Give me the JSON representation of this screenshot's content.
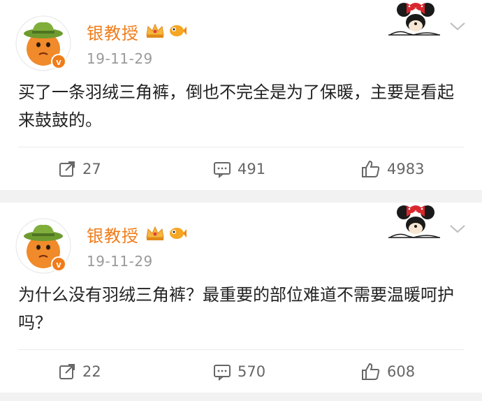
{
  "posts": [
    {
      "username": "银教授",
      "timestamp": "19-11-29",
      "content": "买了一条羽绒三角裤，倒也不完全是为了保暖，主要是看起来鼓鼓的。",
      "reposts": "27",
      "comments": "491",
      "likes": "4983"
    },
    {
      "username": "银教授",
      "timestamp": "19-11-29",
      "content": "为什么没有羽绒三角裤？最重要的部位难道不需要温暖呵护吗？",
      "reposts": "22",
      "comments": "570",
      "likes": "608"
    }
  ],
  "colors": {
    "username": "#f07c1a",
    "verified": "#f07c1a",
    "text": "#222222",
    "muted": "#9a9a9a",
    "background": "#f2f2f2"
  },
  "icons": {
    "avatar": "cartoon-cowboy-avatar",
    "verified": "verified-v-badge",
    "crown": "crown-badge",
    "fish": "fish-badge",
    "decor": "minnie-mouse-decoration",
    "chevron": "chevron-down-icon",
    "repost": "repost-icon",
    "comment": "comment-icon",
    "like": "thumbs-up-icon"
  }
}
